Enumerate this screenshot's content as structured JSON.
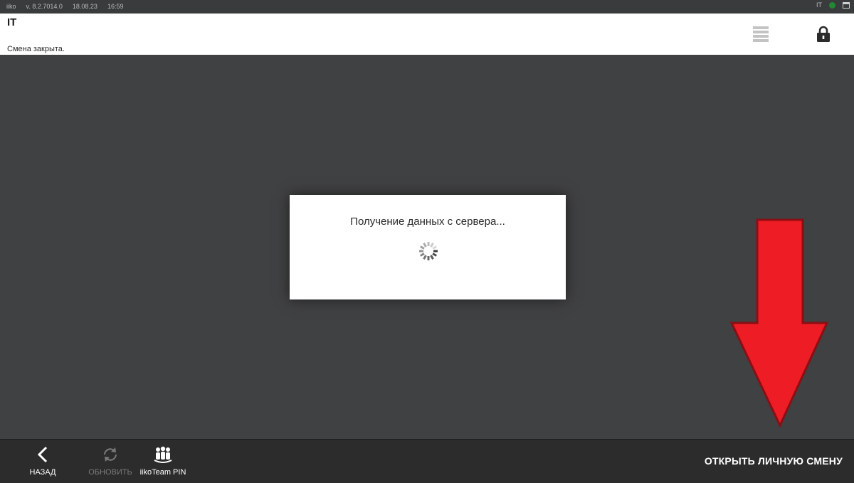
{
  "statusbar": {
    "app": "iiko",
    "version": "v. 8.2.7014.0",
    "date": "18.08.23",
    "time": "16:59",
    "user_code": "IT"
  },
  "header": {
    "title": "IT",
    "subtitle": "Смена закрыта.",
    "menu_icon": "hamburger-icon",
    "lock_icon": "lock-icon"
  },
  "modal": {
    "message": "Получение данных с сервера...",
    "spinner": "loading-spinner-icon"
  },
  "annotation": {
    "arrow_color": "#ee1c25"
  },
  "bottombar": {
    "back_label": "НАЗАД",
    "refresh_label": "ОБНОВИТЬ",
    "pin_label": "iikoTeam PIN",
    "open_shift_label": "ОТКРЫТЬ ЛИЧНУЮ СМЕНУ"
  },
  "colors": {
    "dark_bg": "#404142",
    "bottombar": "#2c2c2d",
    "status_ok": "#1e8a34"
  }
}
